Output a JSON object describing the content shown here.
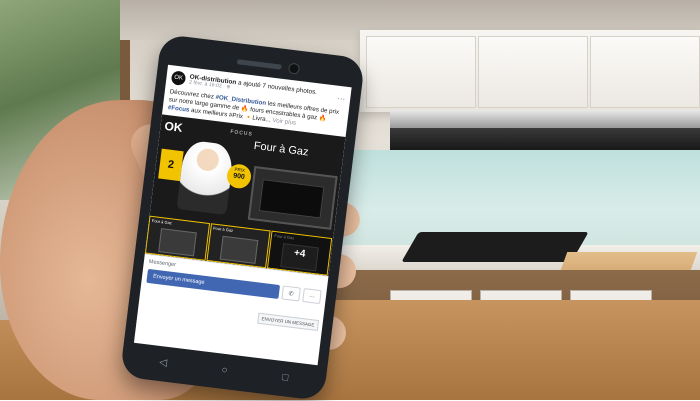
{
  "post": {
    "page_name": "OK-distribution",
    "action_text": "a ajouté 7 nouvelles photos.",
    "time": "2 févr. à 16:02 · ⊕",
    "body_prefix": "Découvrez chez ",
    "body_tag1": "#OK_Distribution",
    "body_mid": " les meilleurs offres de prix sur notre large gamme de 🔥 fours encastrables à gaz 🔥",
    "body_tag2": "#Focus",
    "body_end": " aux meilleurs #Prix 🔸Livra...",
    "see_more": "Voir plus"
  },
  "ad": {
    "logo": "OK",
    "brand": "FOCUS",
    "title_main": "Four à Gaz",
    "badge": "2",
    "price_label": "PRIX",
    "price_value": "900",
    "thumb_label": "Four à Gaz",
    "more_count": "+4"
  },
  "messenger": {
    "label": "Messenger",
    "send_button": "Envoyer un message",
    "cta_button": "ENVOYER UN MESSAGE",
    "call_icon": "phone-icon"
  },
  "nav": {
    "back": "◁",
    "home": "○",
    "recent": "□"
  }
}
